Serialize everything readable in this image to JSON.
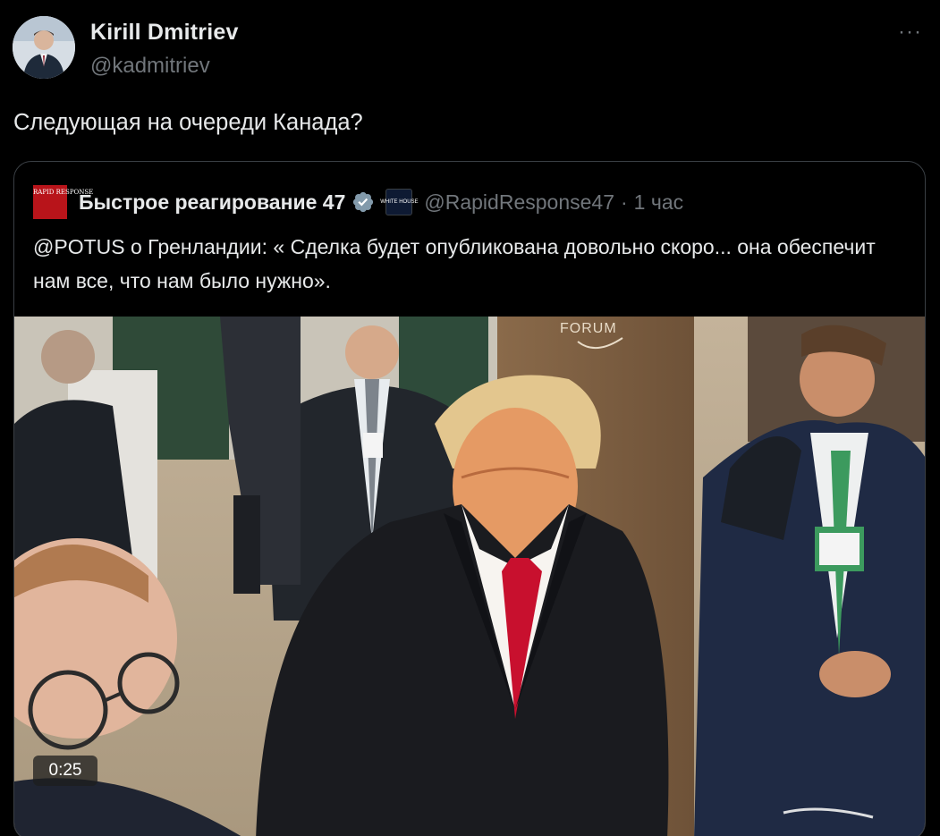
{
  "author": {
    "name": "Kirill Dmitriev",
    "handle": "@kadmitriev"
  },
  "more_label": "···",
  "tweet": {
    "text": "Следующая на очереди Канада?"
  },
  "quote": {
    "logo_text": "RAPID RESPONSE",
    "name": "Быстрое реагирование 47",
    "affiliate_badge_text": "WHITE HOUSE",
    "handle": "@RapidResponse47",
    "separator": "·",
    "time": "1 час",
    "text": "@POTUS о Гренландии: « Сделка будет опубликована довольно скоро... она обеспечит нам все, что нам было нужно».",
    "media": {
      "type": "video",
      "duration": "0:25",
      "sign_text": "FORUM"
    }
  },
  "colors": {
    "background": "#000000",
    "text_primary": "#e7e9ea",
    "text_secondary": "#71767b",
    "border": "#3a3f44",
    "verified_blue": "#1d9bf0",
    "logo_red": "#b8141a"
  }
}
